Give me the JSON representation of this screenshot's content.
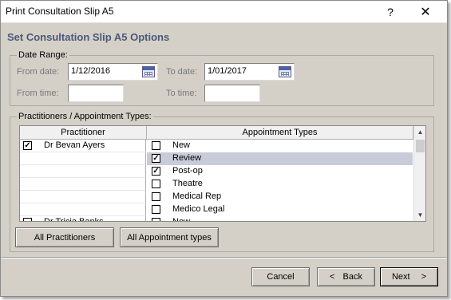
{
  "window": {
    "title": "Print Consultation Slip A5",
    "help_label": "?",
    "close_label": "✕"
  },
  "heading": "Set Consultation Slip A5 Options",
  "date_range": {
    "legend": "Date Range:",
    "from_date_label": "From date:",
    "from_date_value": "1/12/2016",
    "to_date_label": "To date:",
    "to_date_value": "1/01/2017",
    "from_time_label": "From time:",
    "from_time_value": "",
    "to_time_label": "To time:",
    "to_time_value": ""
  },
  "practitioners": {
    "legend": "Practitioners / Appointment Types:",
    "columns": [
      "Practitioner",
      "Appointment Types"
    ],
    "rows": [
      {
        "practitioner": "Dr Bevan Ayers",
        "practitioner_checked": true,
        "type": "New",
        "type_checked": false,
        "selected": false
      },
      {
        "practitioner": "",
        "practitioner_checked": null,
        "type": "Review",
        "type_checked": true,
        "selected": true
      },
      {
        "practitioner": "",
        "practitioner_checked": null,
        "type": "Post-op",
        "type_checked": true,
        "selected": false
      },
      {
        "practitioner": "",
        "practitioner_checked": null,
        "type": "Theatre",
        "type_checked": false,
        "selected": false
      },
      {
        "practitioner": "",
        "practitioner_checked": null,
        "type": "Medical Rep",
        "type_checked": false,
        "selected": false
      },
      {
        "practitioner": "",
        "practitioner_checked": null,
        "type": "Medico Legal",
        "type_checked": false,
        "selected": false
      },
      {
        "practitioner": "Dr Tricia Banks",
        "practitioner_checked": false,
        "type": "New",
        "type_checked": false,
        "selected": false
      }
    ],
    "all_practitioners_label": "All Practitioners",
    "all_types_label": "All Appointment types"
  },
  "footer": {
    "cancel_label": "Cancel",
    "back_label": "Back",
    "back_arrow": "<",
    "next_label": "Next",
    "next_arrow": ">"
  }
}
